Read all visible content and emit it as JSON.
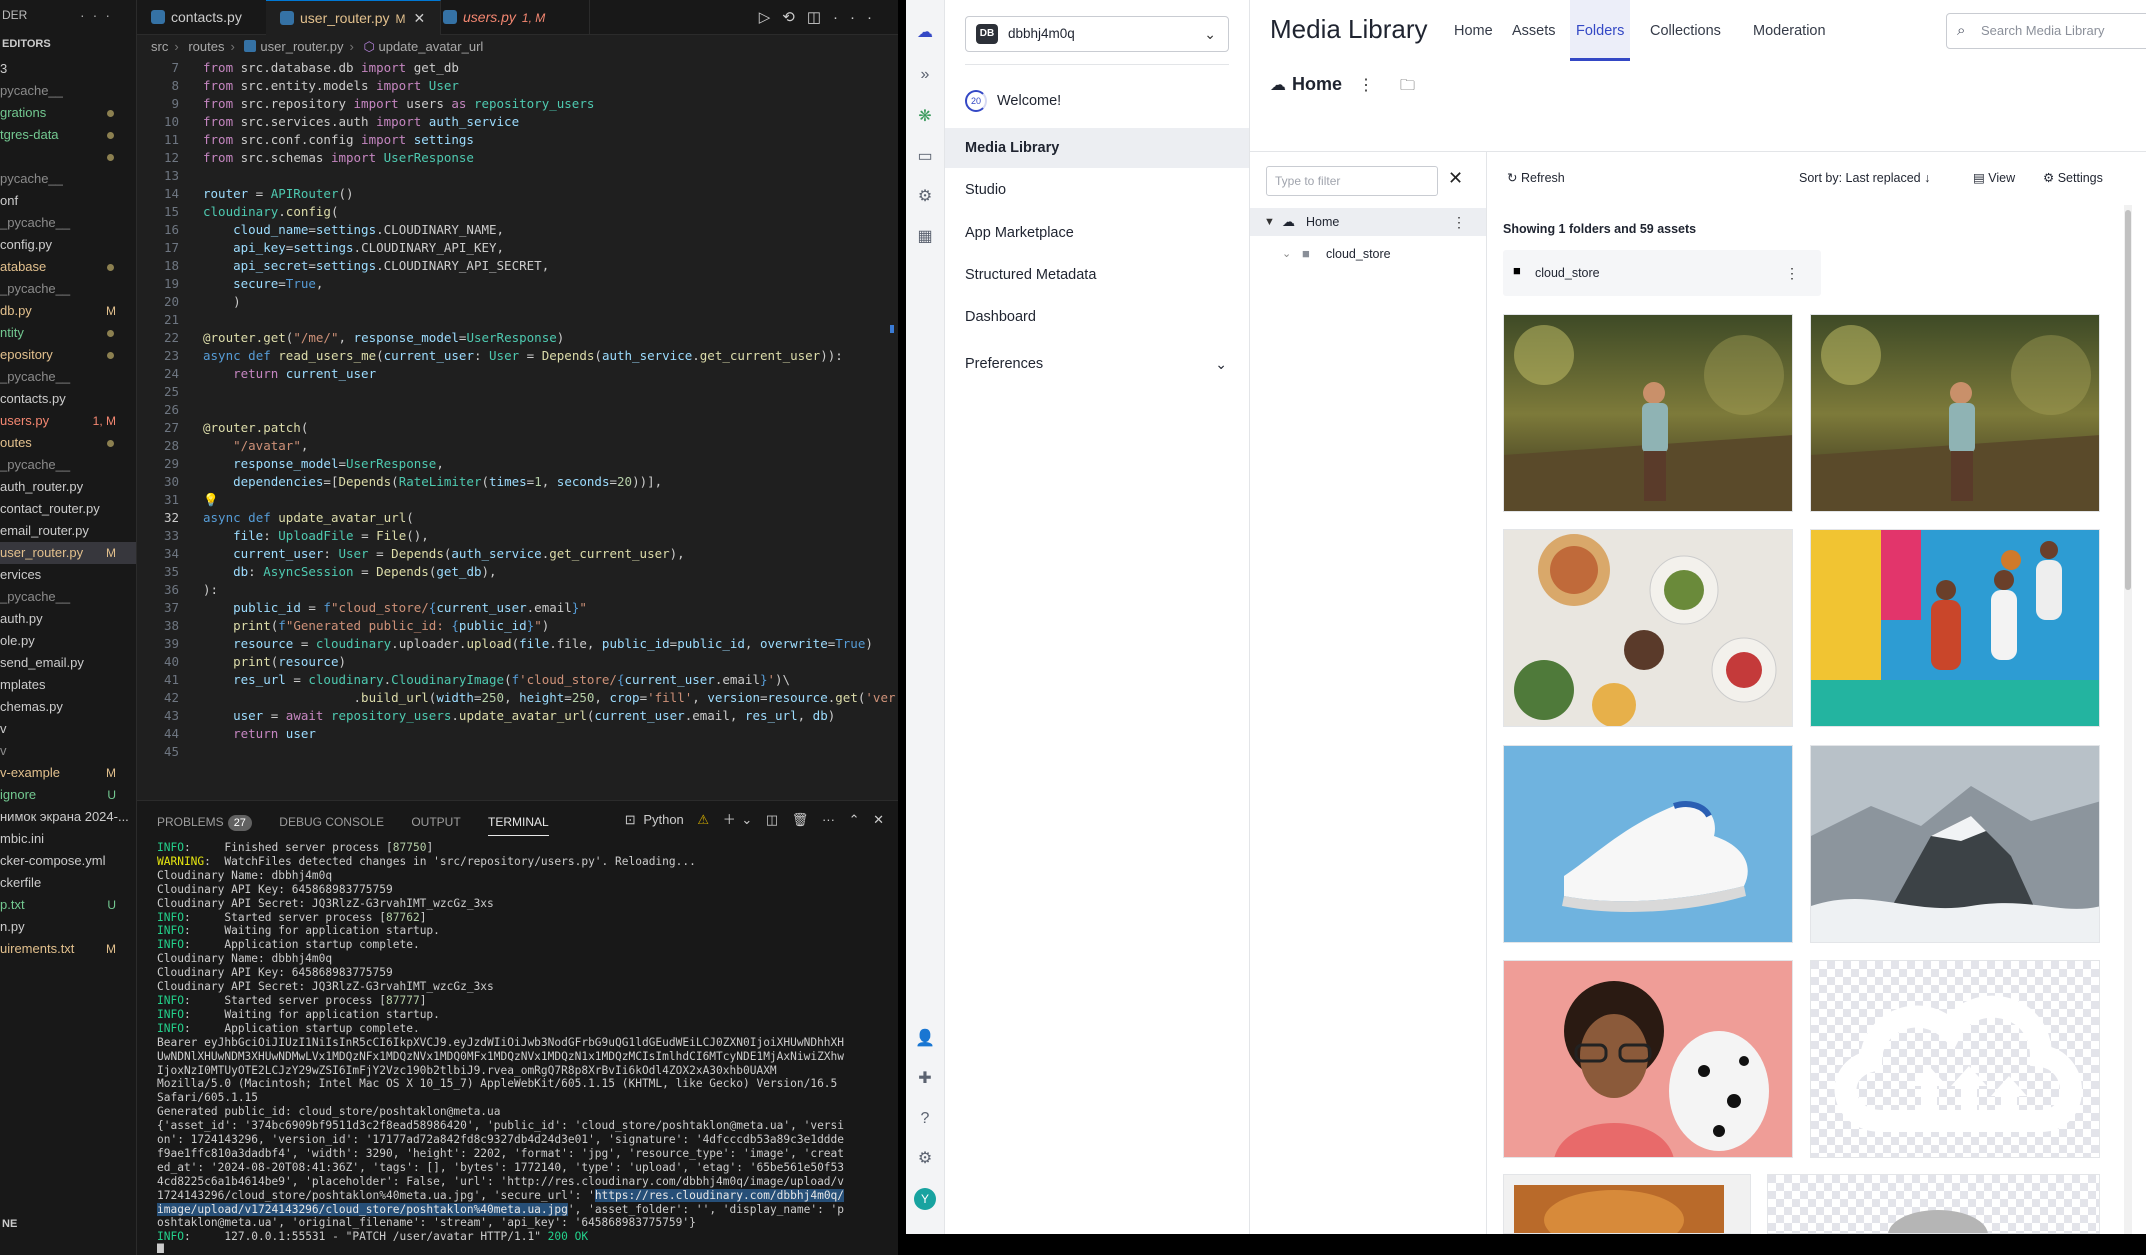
{
  "vscode": {
    "explorer_header": "DER",
    "editors_label": "EDITORS",
    "explorer_items": [
      {
        "label": "3",
        "color": "#cccccc",
        "dec": ""
      },
      {
        "label": "pycache__",
        "color": "#8b8b8b",
        "dec": ""
      },
      {
        "label": "grations",
        "color": "#73c991",
        "dec": "dot"
      },
      {
        "label": "tgres-data",
        "color": "#73c991",
        "dec": "dot"
      },
      {
        "label": "",
        "color": "#cccccc",
        "dec": "dot"
      },
      {
        "label": "pycache__",
        "color": "#8b8b8b",
        "dec": ""
      },
      {
        "label": "onf",
        "color": "#cccccc",
        "dec": ""
      },
      {
        "label": "_pycache__",
        "color": "#8b8b8b",
        "dec": ""
      },
      {
        "label": "config.py",
        "color": "#cccccc",
        "dec": ""
      },
      {
        "label": "atabase",
        "color": "#e2c08d",
        "dec": "dot"
      },
      {
        "label": "_pycache__",
        "color": "#8b8b8b",
        "dec": ""
      },
      {
        "label": "db.py",
        "color": "#e2c08d",
        "dec": "M"
      },
      {
        "label": "ntity",
        "color": "#73c991",
        "dec": "dot"
      },
      {
        "label": "epository",
        "color": "#e2c08d",
        "dec": "dot"
      },
      {
        "label": "_pycache__",
        "color": "#8b8b8b",
        "dec": ""
      },
      {
        "label": "contacts.py",
        "color": "#cccccc",
        "dec": ""
      },
      {
        "label": "users.py",
        "color": "#f48771",
        "dec": "1, M"
      },
      {
        "label": "outes",
        "color": "#e2c08d",
        "dec": "dot"
      },
      {
        "label": "_pycache__",
        "color": "#8b8b8b",
        "dec": ""
      },
      {
        "label": "auth_router.py",
        "color": "#cccccc",
        "dec": ""
      },
      {
        "label": "contact_router.py",
        "color": "#cccccc",
        "dec": ""
      },
      {
        "label": "email_router.py",
        "color": "#cccccc",
        "dec": ""
      },
      {
        "label": "user_router.py",
        "color": "#e2c08d",
        "dec": "M",
        "selected": true
      },
      {
        "label": "ervices",
        "color": "#cccccc",
        "dec": ""
      },
      {
        "label": "_pycache__",
        "color": "#8b8b8b",
        "dec": ""
      },
      {
        "label": "auth.py",
        "color": "#cccccc",
        "dec": ""
      },
      {
        "label": "ole.py",
        "color": "#cccccc",
        "dec": ""
      },
      {
        "label": "send_email.py",
        "color": "#cccccc",
        "dec": ""
      },
      {
        "label": "mplates",
        "color": "#cccccc",
        "dec": ""
      },
      {
        "label": "chemas.py",
        "color": "#cccccc",
        "dec": ""
      },
      {
        "label": "v",
        "color": "#cccccc",
        "dec": ""
      },
      {
        "label": "v",
        "color": "#8b8b8b",
        "dec": ""
      },
      {
        "label": "v-example",
        "color": "#e2c08d",
        "dec": "M"
      },
      {
        "label": "ignore",
        "color": "#73c991",
        "dec": "U"
      },
      {
        "label": "нимок экрана 2024-...",
        "color": "#cccccc",
        "dec": ""
      },
      {
        "label": "mbic.ini",
        "color": "#cccccc",
        "dec": ""
      },
      {
        "label": "cker-compose.yml",
        "color": "#cccccc",
        "dec": ""
      },
      {
        "label": "ckerfile",
        "color": "#cccccc",
        "dec": ""
      },
      {
        "label": "p.txt",
        "color": "#73c991",
        "dec": "U"
      },
      {
        "label": "n.py",
        "color": "#cccccc",
        "dec": ""
      },
      {
        "label": "uirements.txt",
        "color": "#e2c08d",
        "dec": "M"
      }
    ],
    "outline_label": "NE",
    "tabs": [
      {
        "label": "contacts.py",
        "status": "",
        "color": "#cccccc"
      },
      {
        "label": "user_router.py",
        "status": "M",
        "color": "#e2c08d"
      },
      {
        "label": "users.py",
        "status": "1, M",
        "color": "#f48771"
      }
    ],
    "breadcrumb": [
      "src",
      "routes",
      "user_router.py",
      "update_avatar_url"
    ],
    "code_line_numbers": [
      "7",
      "8",
      "9",
      "10",
      "11",
      "12",
      "13",
      "14",
      "15",
      "16",
      "17",
      "18",
      "19",
      "20",
      "21",
      "22",
      "23",
      "24",
      "25",
      "26",
      "27",
      "28",
      "29",
      "30",
      "31",
      "32",
      "33",
      "34",
      "35",
      "36",
      "37",
      "38",
      "39",
      "40",
      "41",
      "42",
      "43",
      "44",
      "45"
    ],
    "current_line": "32",
    "panel_tabs": {
      "problems": "PROBLEMS",
      "problems_count": "27",
      "debug": "DEBUG CONSOLE",
      "output": "OUTPUT",
      "terminal": "TERMINAL"
    },
    "terminal_profile": "Python"
  },
  "cloudinary": {
    "account": {
      "initials": "DB",
      "name": "dbbhj4m0q"
    },
    "welcome": {
      "progress": "20",
      "label": "Welcome!"
    },
    "nav_items": [
      "Media Library",
      "Studio",
      "App Marketplace",
      "Structured Metadata",
      "Dashboard",
      "Preferences"
    ],
    "title": "Media Library",
    "top_links": [
      "Home",
      "Assets",
      "Folders",
      "Collections",
      "Moderation"
    ],
    "active_top_link": "Folders",
    "search_placeholder": "Search Media Library",
    "current_folder": "Home",
    "filter_placeholder": "Type to filter",
    "tree": [
      {
        "label": "Home"
      },
      {
        "label": "cloud_store"
      }
    ],
    "toolbar": {
      "refresh": "Refresh",
      "sort": "Sort by: Last replaced",
      "view": "View",
      "settings": "Settings"
    },
    "showing": "Showing 1 folders and 59 assets",
    "folder_card": "cloud_store",
    "assets": [
      "woman-field-photo",
      "woman-field-photo",
      "food-table-photo",
      "basketball-players-photo",
      "sneaker-photo",
      "mountain-peak-photo",
      "woman-with-dog-photo",
      "cloudinary-logo-placeholder",
      "dog-photo",
      "placeholder-image"
    ],
    "user_avatar": "Y"
  }
}
